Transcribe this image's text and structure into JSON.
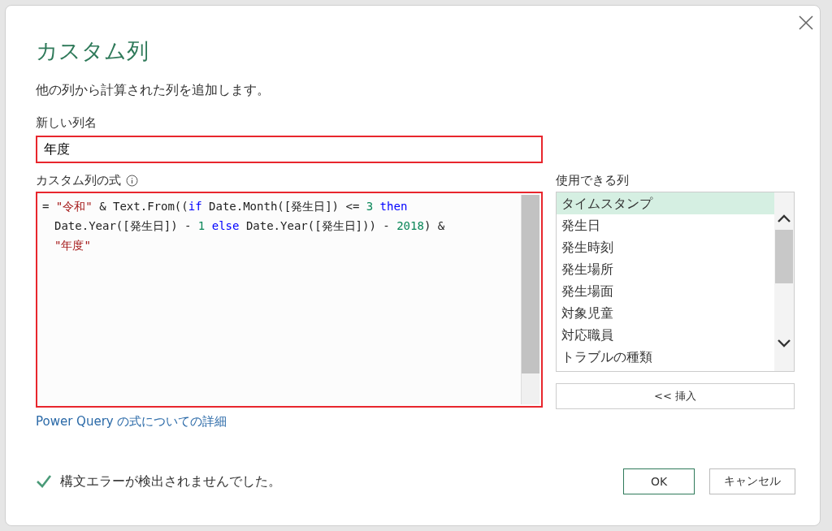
{
  "dialog": {
    "title": "カスタム列",
    "description": "他の列から計算された列を追加します。",
    "new_column": {
      "label": "新しい列名",
      "value": "年度"
    },
    "formula": {
      "label": "カスタム列の式",
      "lines": [
        [
          {
            "text": "= ",
            "kind": "plain"
          },
          {
            "text": "\"令和\"",
            "kind": "string"
          },
          {
            "text": " & Text.From((",
            "kind": "plain"
          },
          {
            "text": "if",
            "kind": "keyword"
          },
          {
            "text": " Date.Month([発生日]) <= ",
            "kind": "plain"
          },
          {
            "text": "3",
            "kind": "number"
          },
          {
            "text": " then",
            "kind": "keyword"
          }
        ],
        [
          {
            "text": "Date.Year([発生日]) - ",
            "kind": "plain"
          },
          {
            "text": "1",
            "kind": "number"
          },
          {
            "text": " else",
            "kind": "keyword"
          },
          {
            "text": " Date.Year([発生日])) - ",
            "kind": "plain"
          },
          {
            "text": "2018",
            "kind": "number"
          },
          {
            "text": ") &",
            "kind": "plain"
          }
        ],
        [
          {
            "text": "\"年度\"",
            "kind": "string"
          }
        ]
      ]
    },
    "available_columns": {
      "label": "使用できる列",
      "items": [
        {
          "name": "タイムスタンプ",
          "selected": true
        },
        {
          "name": "発生日",
          "selected": false
        },
        {
          "name": "発生時刻",
          "selected": false
        },
        {
          "name": "発生場所",
          "selected": false
        },
        {
          "name": "発生場面",
          "selected": false
        },
        {
          "name": "対象児童",
          "selected": false
        },
        {
          "name": "対応職員",
          "selected": false
        },
        {
          "name": "トラブルの種類",
          "selected": false
        }
      ],
      "insert_button": "<< 挿入"
    },
    "link": "Power Query の式についての詳細",
    "status": "構文エラーが検出されませんでした。",
    "buttons": {
      "ok": "OK",
      "cancel": "キャンセル"
    }
  }
}
